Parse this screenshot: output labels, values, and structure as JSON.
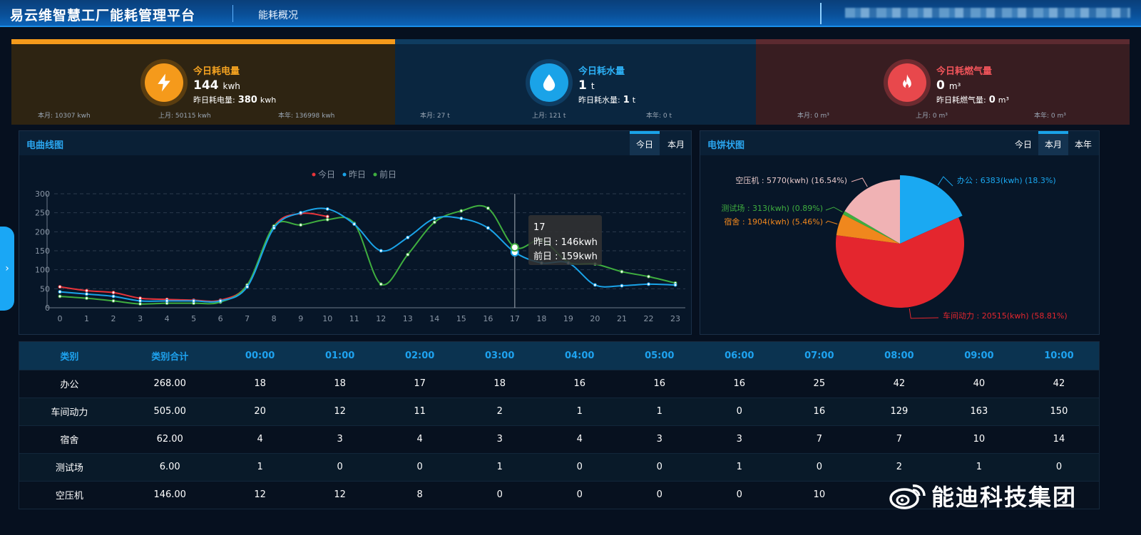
{
  "header": {
    "app_title": "易云维智慧工厂能耗管理平台",
    "page_name": "能耗概况"
  },
  "kpi": {
    "electric": {
      "label": "今日耗电量",
      "value": "144",
      "unit": "kwh",
      "yesterday_label": "昨日耗电量:",
      "yesterday_value": "380",
      "yesterday_unit": "kwh",
      "month": "本月: 10307  kwh",
      "last_month": "上月: 50115  kwh",
      "year": "本年: 136998  kwh",
      "color": "#f59a1b"
    },
    "water": {
      "label": "今日耗水量",
      "value": "1",
      "unit": "t",
      "yesterday_label": "昨日耗水量:",
      "yesterday_value": "1",
      "yesterday_unit": "t",
      "month": "本月: 27  t",
      "last_month": "上月: 121  t",
      "year": "本年: 0  t",
      "color": "#1aa3e8"
    },
    "gas": {
      "label": "今日耗燃气量",
      "value": "0",
      "unit": "m³",
      "yesterday_label": "昨日耗燃气量:",
      "yesterday_value": "0",
      "yesterday_unit": "m³",
      "month": "本月: 0  m³",
      "last_month": "上月: 0  m³",
      "year": "本年: 0  m³",
      "color": "#e8484c"
    }
  },
  "line_panel": {
    "title": "电曲线图",
    "tabs": [
      "今日",
      "本月"
    ],
    "active_tab": "今日",
    "tooltip": {
      "title": "17",
      "lines": [
        "昨日 : 146kwh",
        "前日 : 159kwh"
      ]
    }
  },
  "pie_panel": {
    "title": "电饼状图",
    "tabs": [
      "今日",
      "本月",
      "本年"
    ],
    "active_tab": "本月"
  },
  "chart_data": [
    {
      "type": "line",
      "title": "",
      "x": [
        "0",
        "1",
        "2",
        "3",
        "4",
        "5",
        "6",
        "7",
        "8",
        "9",
        "10",
        "11",
        "12",
        "13",
        "14",
        "15",
        "16",
        "17",
        "18",
        "19",
        "20",
        "21",
        "22",
        "23"
      ],
      "ylim": [
        0,
        300
      ],
      "yticks": [
        0,
        50,
        100,
        150,
        200,
        250,
        300
      ],
      "grid": "horizontal dashed",
      "legend": "top-center",
      "series": [
        {
          "name": "今日",
          "color": "#e8343a",
          "values": [
            55,
            45,
            40,
            25,
            22,
            20,
            20,
            60,
            215,
            248,
            240
          ]
        },
        {
          "name": "昨日",
          "color": "#1aa3e8",
          "values": [
            42,
            36,
            30,
            18,
            18,
            18,
            18,
            55,
            210,
            250,
            260,
            220,
            150,
            185,
            235,
            235,
            210,
            146,
            118,
            118,
            60,
            58,
            62,
            60
          ]
        },
        {
          "name": "前日",
          "color": "#3fae3f",
          "values": [
            30,
            25,
            18,
            10,
            12,
            12,
            15,
            60,
            215,
            218,
            232,
            222,
            62,
            140,
            225,
            255,
            262,
            159,
            178,
            120,
            115,
            95,
            82,
            65
          ]
        }
      ]
    },
    {
      "type": "pie",
      "title": "",
      "unit": "kwh",
      "slices": [
        {
          "label": "办公",
          "value": 6383,
          "percent": 18.3,
          "color": "#1aa9f2",
          "text": "办公 : 6383(kwh) (18.3%)"
        },
        {
          "label": "车间动力",
          "value": 20515,
          "percent": 58.81,
          "color": "#e4262e",
          "text": "车间动力 : 20515(kwh) (58.81%)"
        },
        {
          "label": "宿舍",
          "value": 1904,
          "percent": 5.46,
          "color": "#f0871d",
          "text": "宿舍 : 1904(kwh) (5.46%)"
        },
        {
          "label": "测试场",
          "value": 313,
          "percent": 0.89,
          "color": "#3fae3f",
          "text": "测试场 : 313(kwh) (0.89%)"
        },
        {
          "label": "空压机",
          "value": 5770,
          "percent": 16.54,
          "color": "#f0b2b4",
          "text": "空压机 : 5770(kwh) (16.54%)"
        }
      ]
    },
    {
      "type": "table",
      "columns": [
        "类别",
        "类别合计",
        "00:00",
        "01:00",
        "02:00",
        "03:00",
        "04:00",
        "05:00",
        "06:00",
        "07:00",
        "08:00",
        "09:00",
        "10:00"
      ],
      "rows": [
        [
          "办公",
          "268.00",
          "18",
          "18",
          "17",
          "18",
          "16",
          "16",
          "16",
          "25",
          "42",
          "40",
          "42"
        ],
        [
          "车间动力",
          "505.00",
          "20",
          "12",
          "11",
          "2",
          "1",
          "1",
          "0",
          "16",
          "129",
          "163",
          "150"
        ],
        [
          "宿舍",
          "62.00",
          "4",
          "3",
          "4",
          "3",
          "4",
          "3",
          "3",
          "7",
          "7",
          "10",
          "14"
        ],
        [
          "测试场",
          "6.00",
          "1",
          "0",
          "0",
          "1",
          "0",
          "0",
          "1",
          "0",
          "2",
          "1",
          "0"
        ],
        [
          "空压机",
          "146.00",
          "12",
          "12",
          "8",
          "0",
          "0",
          "0",
          "0",
          "10",
          "",
          "",
          ""
        ]
      ]
    }
  ],
  "watermark": {
    "text": "能迪科技集团"
  }
}
